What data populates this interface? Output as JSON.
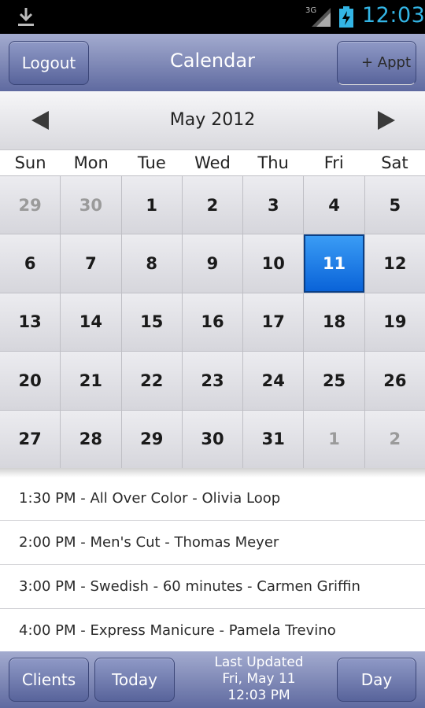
{
  "status_bar": {
    "network": "3G",
    "time": "12:03",
    "icons": [
      "download-icon",
      "signal-icon",
      "battery-charging-icon"
    ]
  },
  "header": {
    "logout_label": "Logout",
    "title": "Calendar",
    "add_appt_label": "+ Appt"
  },
  "calendar": {
    "month_label": "May 2012",
    "weekdays": [
      "Sun",
      "Mon",
      "Tue",
      "Wed",
      "Thu",
      "Fri",
      "Sat"
    ],
    "selected_day": "11",
    "selected_color": "#1a7fe8",
    "weeks": [
      [
        {
          "d": "29",
          "other": true
        },
        {
          "d": "30",
          "other": true
        },
        {
          "d": "1"
        },
        {
          "d": "2"
        },
        {
          "d": "3"
        },
        {
          "d": "4"
        },
        {
          "d": "5"
        }
      ],
      [
        {
          "d": "6"
        },
        {
          "d": "7"
        },
        {
          "d": "8"
        },
        {
          "d": "9"
        },
        {
          "d": "10"
        },
        {
          "d": "11",
          "selected": true
        },
        {
          "d": "12"
        }
      ],
      [
        {
          "d": "13"
        },
        {
          "d": "14"
        },
        {
          "d": "15"
        },
        {
          "d": "16"
        },
        {
          "d": "17"
        },
        {
          "d": "18"
        },
        {
          "d": "19"
        }
      ],
      [
        {
          "d": "20"
        },
        {
          "d": "21"
        },
        {
          "d": "22"
        },
        {
          "d": "23"
        },
        {
          "d": "24"
        },
        {
          "d": "25"
        },
        {
          "d": "26"
        }
      ],
      [
        {
          "d": "27"
        },
        {
          "d": "28"
        },
        {
          "d": "29"
        },
        {
          "d": "30"
        },
        {
          "d": "31"
        },
        {
          "d": "1",
          "other": true
        },
        {
          "d": "2",
          "other": true
        }
      ]
    ]
  },
  "appointments": [
    "1:30 PM - All Over Color - Olivia Loop",
    "2:00 PM - Men's Cut - Thomas Meyer",
    "3:00 PM - Swedish - 60 minutes - Carmen Griffin",
    "4:00 PM - Express Manicure - Pamela Trevino"
  ],
  "footer": {
    "clients_label": "Clients",
    "today_label": "Today",
    "last_updated_title": "Last Updated",
    "last_updated_date": "Fri, May 11",
    "last_updated_time": "12:03 PM",
    "day_label": "Day"
  }
}
